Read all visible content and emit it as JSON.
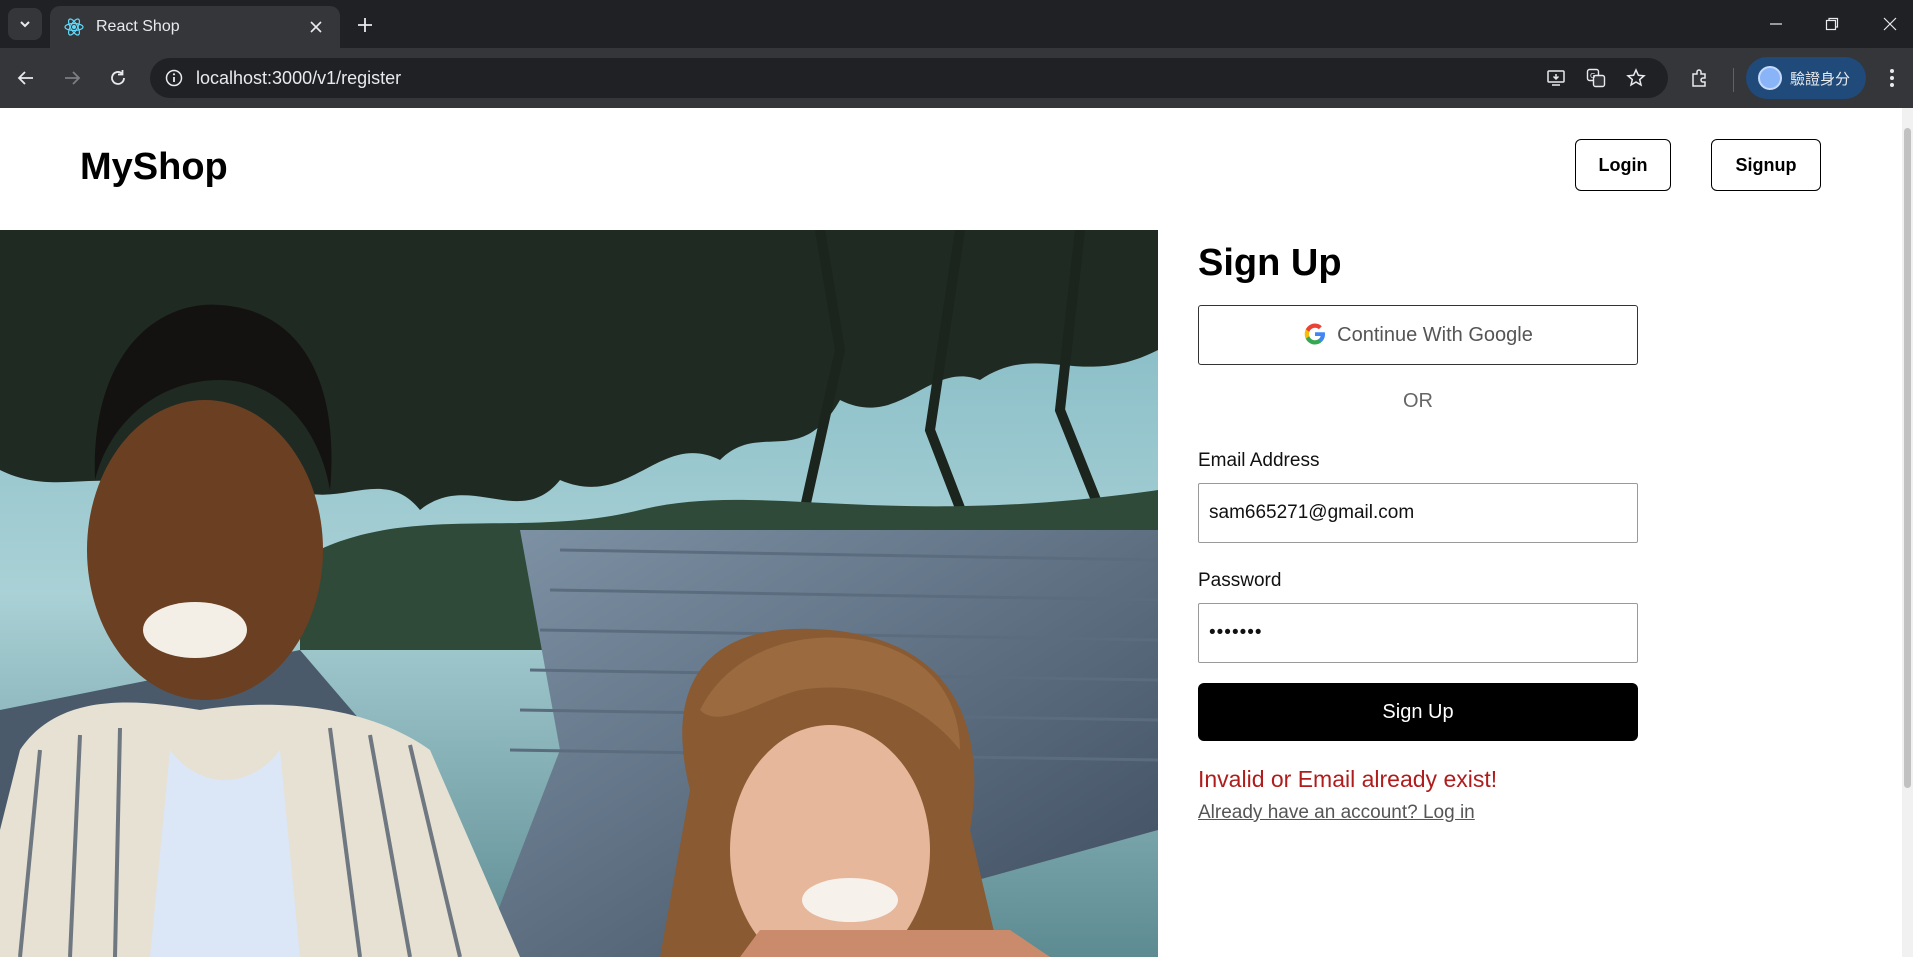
{
  "browser": {
    "tab_title": "React Shop",
    "url": "localhost:3000/v1/register",
    "profile_label": "驗證身分",
    "icons": [
      "tab-list-icon",
      "react-favicon",
      "close-icon",
      "plus-icon",
      "minimize-icon",
      "restore-icon",
      "close-window-icon",
      "back-arrow-icon",
      "forward-arrow-icon",
      "reload-icon",
      "info-icon",
      "install-app-icon",
      "translate-icon",
      "star-icon",
      "extensions-icon",
      "more-vert-icon"
    ]
  },
  "navbar": {
    "brand": "MyShop",
    "login_label": "Login",
    "signup_label": "Signup"
  },
  "form": {
    "title": "Sign Up",
    "google_label": "Continue With Google",
    "or_text": "OR",
    "email_label": "Email Address",
    "email_value": "sam665271@gmail.com",
    "password_label": "Password",
    "password_value": "•••••••",
    "submit_label": "Sign Up",
    "error_message": "Invalid or Email already exist!",
    "login_link": "Already have an account? Log in"
  },
  "colors": {
    "chrome_dark": "#202124",
    "chrome_toolbar": "#35363a",
    "error": "#b01c1c",
    "button_primary": "#000000"
  }
}
